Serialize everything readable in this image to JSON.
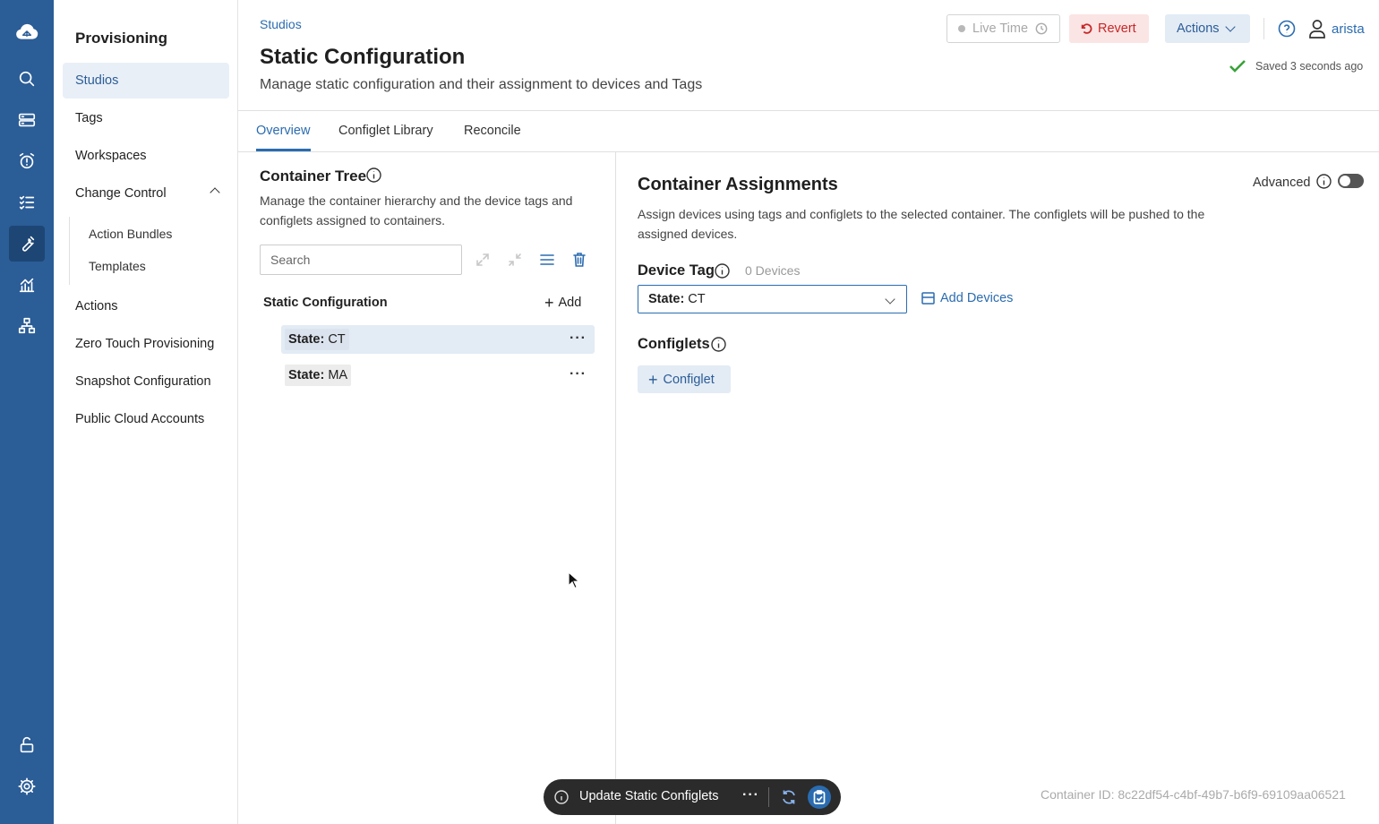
{
  "rail": {
    "items": [
      {
        "icon": "cloud-logo-icon"
      },
      {
        "icon": "search-icon"
      },
      {
        "icon": "devices-icon"
      },
      {
        "icon": "events-alarm-icon"
      },
      {
        "icon": "task-list-icon"
      },
      {
        "icon": "provisioning-wrench-icon",
        "active": true
      },
      {
        "icon": "dashboards-chart-icon"
      },
      {
        "icon": "topology-icon"
      },
      {
        "icon": "unlock-icon"
      },
      {
        "icon": "settings-gear-icon"
      }
    ]
  },
  "sidebar": {
    "title": "Provisioning",
    "items": [
      {
        "label": "Studios",
        "active": true
      },
      {
        "label": "Tags"
      },
      {
        "label": "Workspaces"
      },
      {
        "label": "Change Control",
        "expanded": true
      }
    ],
    "change_control_children": [
      {
        "label": "Action Bundles"
      },
      {
        "label": "Templates"
      }
    ],
    "items_after": [
      {
        "label": "Actions"
      },
      {
        "label": "Zero Touch Provisioning"
      },
      {
        "label": "Snapshot Configuration"
      },
      {
        "label": "Public Cloud Accounts"
      }
    ]
  },
  "header": {
    "breadcrumb": "Studios",
    "title": "Static Configuration",
    "subtitle": "Manage static configuration and their assignment to devices and Tags",
    "live_time_label": "Live Time",
    "revert_label": "Revert",
    "actions_label": "Actions",
    "username": "arista",
    "saved_status": "Saved 3 seconds ago"
  },
  "tabs": [
    {
      "label": "Overview",
      "active": true
    },
    {
      "label": "Configlet Library"
    },
    {
      "label": "Reconcile"
    }
  ],
  "container_tree": {
    "title": "Container Tree",
    "description": "Manage the container hierarchy and the device tags and configlets assigned to containers.",
    "search_placeholder": "Search",
    "root_label": "Static Configuration",
    "add_label": "Add",
    "nodes": [
      {
        "key": "State:",
        "value": "CT",
        "selected": true
      },
      {
        "key": "State:",
        "value": "MA",
        "selected": false
      }
    ]
  },
  "assignments": {
    "title": "Container Assignments",
    "advanced_label": "Advanced",
    "advanced_on": false,
    "description": "Assign devices using tags and configlets to the selected container. The configlets will be pushed to the assigned devices.",
    "device_tag_label": "Device Tag",
    "device_count": "0 Devices",
    "selected_tag_key": "State:",
    "selected_tag_value": "CT",
    "add_devices_label": "Add Devices",
    "configlets_label": "Configlets",
    "add_configlet_label": "Configlet"
  },
  "footer": {
    "container_id": "Container ID: 8c22df54-c4bf-49b7-b6f9-69109aa06521"
  },
  "action_bar": {
    "label": "Update Static Configlets"
  },
  "colors": {
    "rail_bg": "#2b5d97",
    "accent": "#2b6cb0",
    "revert_bg": "#fbe4e4",
    "revert_text": "#c62828",
    "saved_check": "#3aa13a",
    "action_bar_bg": "#2b2b2b"
  }
}
